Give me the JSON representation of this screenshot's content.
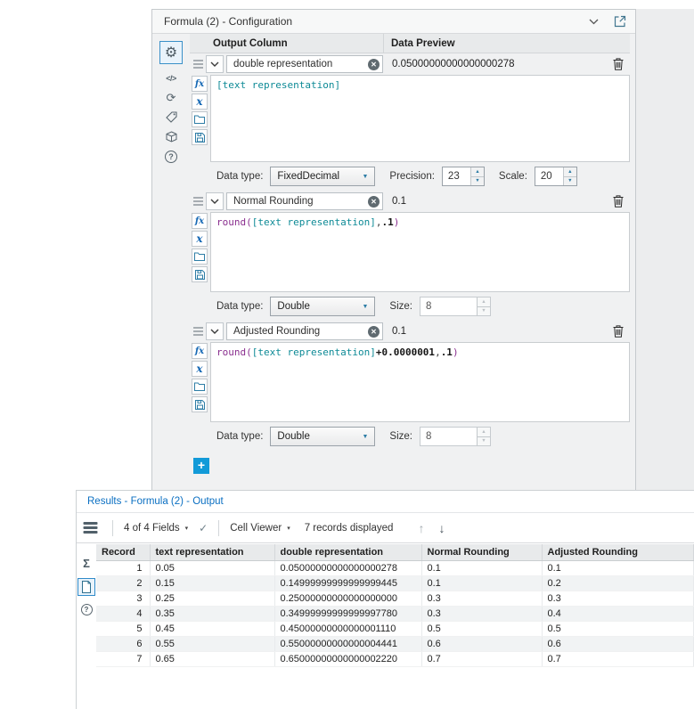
{
  "config": {
    "title": "Formula (2) - Configuration",
    "column_headers": {
      "output": "Output Column",
      "preview": "Data Preview"
    },
    "labels": {
      "data_type": "Data type:"
    },
    "expressions": [
      {
        "name": "double representation",
        "preview": "0.05000000000000000278",
        "code": [
          {
            "c": "field",
            "t": "[text representation]"
          }
        ],
        "data_type": "FixedDecimal",
        "params": [
          {
            "label": "Precision:",
            "value": "23",
            "enabled": true
          },
          {
            "label": "Scale:",
            "value": "20",
            "enabled": true
          }
        ]
      },
      {
        "name": "Normal Rounding",
        "preview": "0.1",
        "code": [
          {
            "c": "func",
            "t": "round("
          },
          {
            "c": "field",
            "t": "[text representation]"
          },
          {
            "c": "punc",
            "t": ","
          },
          {
            "c": "num",
            "t": ".1"
          },
          {
            "c": "func",
            "t": ")"
          }
        ],
        "data_type": "Double",
        "params": [
          {
            "label": "Size:",
            "value": "8",
            "enabled": false
          }
        ]
      },
      {
        "name": "Adjusted Rounding",
        "preview": "0.1",
        "code": [
          {
            "c": "func",
            "t": "round("
          },
          {
            "c": "field",
            "t": "[text representation]"
          },
          {
            "c": "op",
            "t": "+"
          },
          {
            "c": "num",
            "t": "0.0000001"
          },
          {
            "c": "punc",
            "t": ","
          },
          {
            "c": "num",
            "t": ".1"
          },
          {
            "c": "func",
            "t": ")"
          }
        ],
        "data_type": "Double",
        "params": [
          {
            "label": "Size:",
            "value": "8",
            "enabled": false
          }
        ]
      }
    ],
    "add_expression_label": "+"
  },
  "results": {
    "title": "Results - Formula (2) - Output",
    "toolbar": {
      "fields_selector": "4 of 4 Fields",
      "cell_viewer": "Cell Viewer",
      "records_text": "7 records displayed"
    },
    "table": {
      "headers": [
        "Record",
        "text representation",
        "double representation",
        "Normal Rounding",
        "Adjusted Rounding"
      ],
      "rows": [
        [
          "1",
          "0.05",
          "0.05000000000000000278",
          "0.1",
          "0.1"
        ],
        [
          "2",
          "0.15",
          "0.14999999999999999445",
          "0.1",
          "0.2"
        ],
        [
          "3",
          "0.25",
          "0.25000000000000000000",
          "0.3",
          "0.3"
        ],
        [
          "4",
          "0.35",
          "0.34999999999999997780",
          "0.3",
          "0.4"
        ],
        [
          "5",
          "0.45",
          "0.45000000000000001110",
          "0.5",
          "0.5"
        ],
        [
          "6",
          "0.55",
          "0.55000000000000004441",
          "0.6",
          "0.6"
        ],
        [
          "7",
          "0.65",
          "0.65000000000000002220",
          "0.7",
          "0.7"
        ]
      ]
    }
  },
  "icons": {
    "gear": "⚙",
    "code": "</>",
    "refresh": "⟳",
    "help": "?",
    "clear": "✕",
    "caret_down": "▾",
    "spin_up": "▲",
    "spin_down": "▼",
    "check": "✓",
    "arrow_up": "↑",
    "arrow_down": "↓",
    "sigma": "Σ",
    "dropdown_arrow": "▼"
  },
  "colors": {
    "accent_blue": "#2f8ac9",
    "title_blue": "#0a6fc2",
    "field_token": "#0d8a96",
    "func_token": "#8a2f8f",
    "add_button": "#129ad8"
  }
}
